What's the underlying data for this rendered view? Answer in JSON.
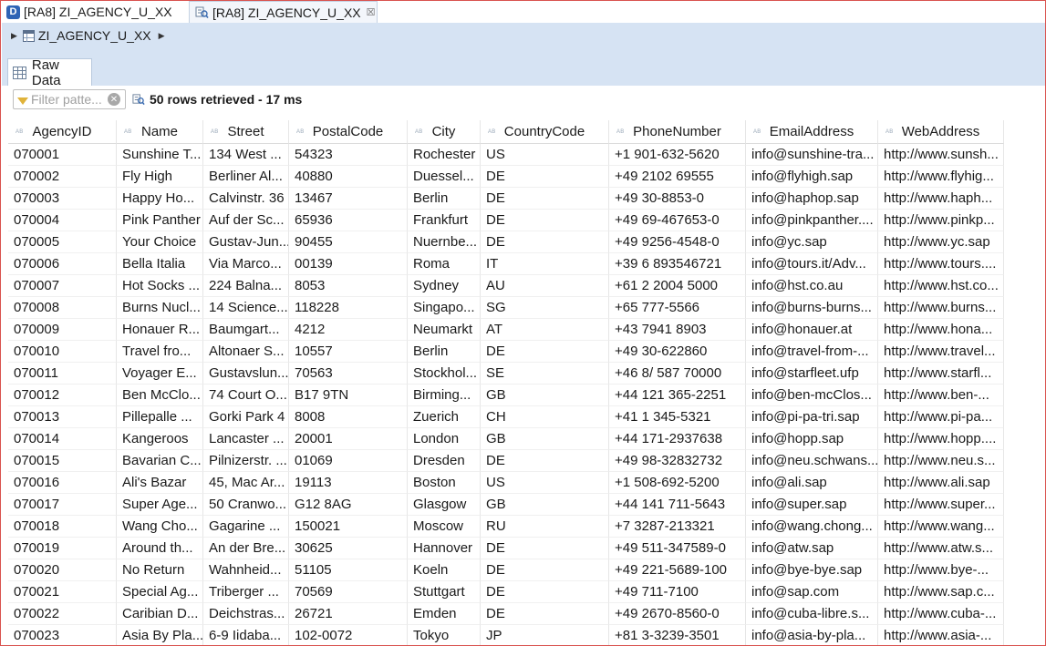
{
  "tabs": [
    {
      "label": "[RA8] ZI_AGENCY_U_XX",
      "icon": "data-definition-icon",
      "active": false
    },
    {
      "label": "[RA8] ZI_AGENCY_U_XX",
      "icon": "data-preview-icon",
      "active": true,
      "close": "☒"
    }
  ],
  "breadcrumb": {
    "entity": "ZI_AGENCY_U_XX"
  },
  "subtab": {
    "label": "Raw Data"
  },
  "filter": {
    "placeholder": "Filter patte..."
  },
  "status": {
    "text": "50 rows retrieved - 17 ms"
  },
  "columns": [
    "AgencyID",
    "Name",
    "Street",
    "PostalCode",
    "City",
    "CountryCode",
    "PhoneNumber",
    "EmailAddress",
    "WebAddress"
  ],
  "column_type_marker": "AB",
  "rows": [
    [
      "070001",
      "Sunshine T...",
      "134 West ...",
      "54323",
      "Rochester",
      "US",
      "+1 901-632-5620",
      "info@sunshine-tra...",
      "http://www.sunsh..."
    ],
    [
      "070002",
      "Fly High",
      "Berliner Al...",
      "40880",
      "Duessel...",
      "DE",
      "+49 2102 69555",
      "info@flyhigh.sap",
      "http://www.flyhig..."
    ],
    [
      "070003",
      "Happy Ho...",
      "Calvinstr. 36",
      "13467",
      "Berlin",
      "DE",
      "+49 30-8853-0",
      "info@haphop.sap",
      "http://www.haph..."
    ],
    [
      "070004",
      "Pink Panther",
      "Auf der Sc...",
      "65936",
      "Frankfurt",
      "DE",
      "+49 69-467653-0",
      "info@pinkpanther....",
      "http://www.pinkp..."
    ],
    [
      "070005",
      "Your Choice",
      "Gustav-Jun...",
      "90455",
      "Nuernbe...",
      "DE",
      "+49 9256-4548-0",
      "info@yc.sap",
      "http://www.yc.sap"
    ],
    [
      "070006",
      "Bella Italia",
      "Via Marco...",
      "00139",
      "Roma",
      "IT",
      "+39 6 893546721",
      "info@tours.it/Adv...",
      "http://www.tours...."
    ],
    [
      "070007",
      "Hot Socks ...",
      "224 Balna...",
      "8053",
      "Sydney",
      "AU",
      "+61 2 2004 5000",
      "info@hst.co.au",
      "http://www.hst.co..."
    ],
    [
      "070008",
      "Burns Nucl...",
      "14 Science...",
      "118228",
      "Singapo...",
      "SG",
      "+65 777-5566",
      "info@burns-burns...",
      "http://www.burns..."
    ],
    [
      "070009",
      "Honauer R...",
      "Baumgart...",
      "4212",
      "Neumarkt",
      "AT",
      "+43 7941 8903",
      "info@honauer.at",
      "http://www.hona..."
    ],
    [
      "070010",
      "Travel fro...",
      "Altonaer S...",
      "10557",
      "Berlin",
      "DE",
      "+49 30-622860",
      "info@travel-from-...",
      "http://www.travel..."
    ],
    [
      "070011",
      "Voyager E...",
      "Gustavslun...",
      "70563",
      "Stockhol...",
      "SE",
      "+46 8/ 587 70000",
      "info@starfleet.ufp",
      "http://www.starfl..."
    ],
    [
      "070012",
      "Ben McClo...",
      "74 Court O...",
      "B17 9TN",
      "Birming...",
      "GB",
      "+44 121 365-2251",
      "info@ben-mcClos...",
      "http://www.ben-..."
    ],
    [
      "070013",
      "Pillepalle ...",
      "Gorki Park 4",
      "8008",
      "Zuerich",
      "CH",
      "+41 1 345-5321",
      "info@pi-pa-tri.sap",
      "http://www.pi-pa..."
    ],
    [
      "070014",
      "Kangeroos",
      "Lancaster ...",
      "20001",
      "London",
      "GB",
      "+44 171-2937638",
      "info@hopp.sap",
      "http://www.hopp...."
    ],
    [
      "070015",
      "Bavarian C...",
      "Pilnizerstr. ...",
      "01069",
      "Dresden",
      "DE",
      "+49 98-32832732",
      "info@neu.schwans...",
      "http://www.neu.s..."
    ],
    [
      "070016",
      "Ali's Bazar",
      "45, Mac Ar...",
      "19113",
      "Boston",
      "US",
      "+1 508-692-5200",
      "info@ali.sap",
      "http://www.ali.sap"
    ],
    [
      "070017",
      "Super Age...",
      "50 Cranwo...",
      "G12 8AG",
      "Glasgow",
      "GB",
      "+44 141 711-5643",
      "info@super.sap",
      "http://www.super..."
    ],
    [
      "070018",
      "Wang Cho...",
      "Gagarine ...",
      "150021",
      "Moscow",
      "RU",
      "+7 3287-213321",
      "info@wang.chong...",
      "http://www.wang..."
    ],
    [
      "070019",
      "Around th...",
      "An der Bre...",
      "30625",
      "Hannover",
      "DE",
      "+49 511-347589-0",
      "info@atw.sap",
      "http://www.atw.s..."
    ],
    [
      "070020",
      "No Return",
      "Wahnheid...",
      "51105",
      "Koeln",
      "DE",
      "+49 221-5689-100",
      "info@bye-bye.sap",
      "http://www.bye-..."
    ],
    [
      "070021",
      "Special Ag...",
      "Triberger ...",
      "70569",
      "Stuttgart",
      "DE",
      "+49 711-7100",
      "info@sap.com",
      "http://www.sap.c..."
    ],
    [
      "070022",
      "Caribian D...",
      "Deichstras...",
      "26721",
      "Emden",
      "DE",
      "+49 2670-8560-0",
      "info@cuba-libre.s...",
      "http://www.cuba-..."
    ],
    [
      "070023",
      "Asia By Pla...",
      "6-9 Iidaba...",
      "102-0072",
      "Tokyo",
      "JP",
      "+81 3-3239-3501",
      "info@asia-by-pla...",
      "http://www.asia-..."
    ]
  ],
  "colors": {
    "band": "#d6e3f3",
    "accent": "#2f64b5",
    "frame": "#d9534f"
  }
}
